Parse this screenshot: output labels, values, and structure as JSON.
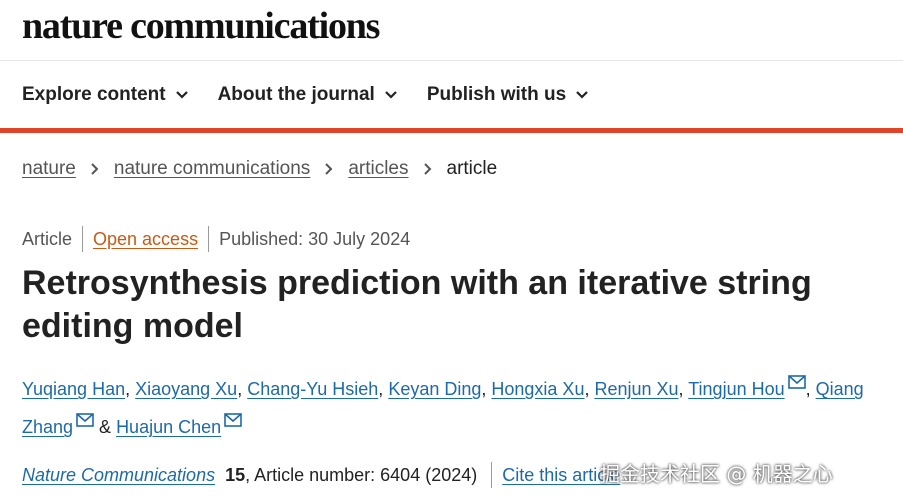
{
  "header": {
    "logo": "nature communications"
  },
  "nav": {
    "items": [
      {
        "label": "Explore content"
      },
      {
        "label": "About the journal"
      },
      {
        "label": "Publish with us"
      }
    ]
  },
  "breadcrumb": {
    "items": [
      {
        "label": "nature"
      },
      {
        "label": "nature communications"
      },
      {
        "label": "articles"
      },
      {
        "label": "article"
      }
    ]
  },
  "meta": {
    "type": "Article",
    "access": "Open access",
    "published": "Published: 30 July 2024"
  },
  "article": {
    "title": "Retrosynthesis prediction with an iterative string editing model",
    "authors": [
      {
        "name": "Yuqiang Han",
        "sep": ", "
      },
      {
        "name": "Xiaoyang Xu",
        "sep": ", "
      },
      {
        "name": "Chang-Yu Hsieh",
        "sep": ", "
      },
      {
        "name": "Keyan Ding",
        "sep": ", "
      },
      {
        "name": "Hongxia Xu",
        "sep": ", "
      },
      {
        "name": "Renjun Xu",
        "sep": ", "
      },
      {
        "name": "Tingjun Hou",
        "sep": ", "
      },
      {
        "name": "Qiang Zhang",
        "sep": " & "
      },
      {
        "name": "Huajun Chen",
        "sep": ""
      }
    ]
  },
  "citation": {
    "journal": "Nature Communications",
    "volume": "15",
    "rest": ", Article number: 6404 (2024)",
    "cite_link": "Cite this article"
  },
  "watermark": "掘金技术社区 @ 机器之心",
  "colors": {
    "accent_red": "#e0442a",
    "link_blue": "#1d6aa8",
    "open_access": "#c75a14"
  }
}
